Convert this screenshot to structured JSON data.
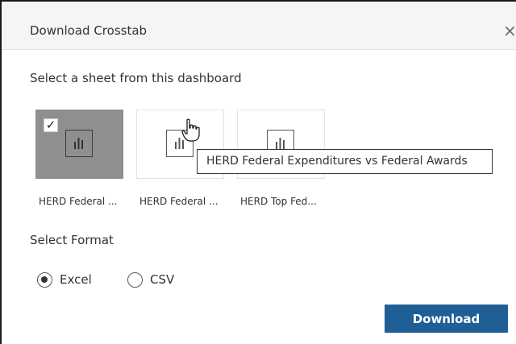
{
  "dialog": {
    "title": "Download Crosstab",
    "close_symbol": "×"
  },
  "sheet_section": {
    "label": "Select a sheet from this dashboard",
    "sheets": [
      {
        "name": "HERD Federal ...",
        "selected": true,
        "icon": "bar-chart-icon"
      },
      {
        "name": "HERD Federal ...",
        "selected": false,
        "icon": "bar-chart-icon"
      },
      {
        "name": "HERD Top Fed...",
        "selected": false,
        "icon": "bar-chart-icon"
      }
    ],
    "checkmark": "✓",
    "tooltip": "HERD Federal Expenditures vs Federal Awards"
  },
  "format_section": {
    "label": "Select Format",
    "options": [
      {
        "label": "Excel",
        "selected": true
      },
      {
        "label": "CSV",
        "selected": false
      }
    ]
  },
  "actions": {
    "download_label": "Download"
  },
  "colors": {
    "accent": "#1f5f96",
    "selected_card": "#8f8f8f",
    "title_bar": "#f5f5f5"
  }
}
